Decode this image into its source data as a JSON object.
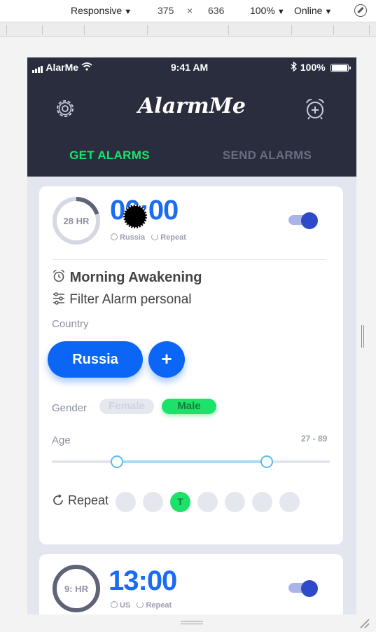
{
  "devtools": {
    "device_mode": "Responsive",
    "width": "375",
    "times": "×",
    "height": "636",
    "zoom": "100%",
    "throttle": "Online"
  },
  "statusbar": {
    "carrier": "AlarMe",
    "time": "9:41 AM",
    "battery": "100%"
  },
  "app": {
    "logo": "AlarmMe",
    "tabs": [
      {
        "label": "GET ALARMS",
        "active": true
      },
      {
        "label": "SEND ALARMS",
        "active": false
      }
    ]
  },
  "alarms": [
    {
      "ring_label": "28 HR",
      "ring_progress": 0.2,
      "time": "00:00",
      "country": "Russia",
      "repeat": "Repeat",
      "enabled": true,
      "title": "Morning Awakening",
      "filter_text": "Filter Alarm personal",
      "country_label": "Country",
      "country_value": "Russia",
      "add_symbol": "+",
      "gender_label": "Gender",
      "gender_options": [
        {
          "label": "Female",
          "selected": false
        },
        {
          "label": "Male",
          "selected": true
        }
      ],
      "age_label": "Age",
      "age_range_text": "27 - 89",
      "age_min": 27,
      "age_max": 89,
      "repeat_label": "Repeat",
      "days": [
        {
          "label": "",
          "selected": false
        },
        {
          "label": "",
          "selected": false
        },
        {
          "label": "T",
          "selected": true
        },
        {
          "label": "",
          "selected": false
        },
        {
          "label": "",
          "selected": false
        },
        {
          "label": "",
          "selected": false
        },
        {
          "label": "",
          "selected": false
        }
      ]
    },
    {
      "ring_label": "9: HR",
      "time": "13:00",
      "country": "US",
      "repeat": "Repeat",
      "enabled": true
    }
  ],
  "colors": {
    "header_bg": "#2a2d3e",
    "accent_blue": "#0c66f5",
    "accent_green": "#1de26a",
    "toggle_knob": "#2f4ac9"
  }
}
